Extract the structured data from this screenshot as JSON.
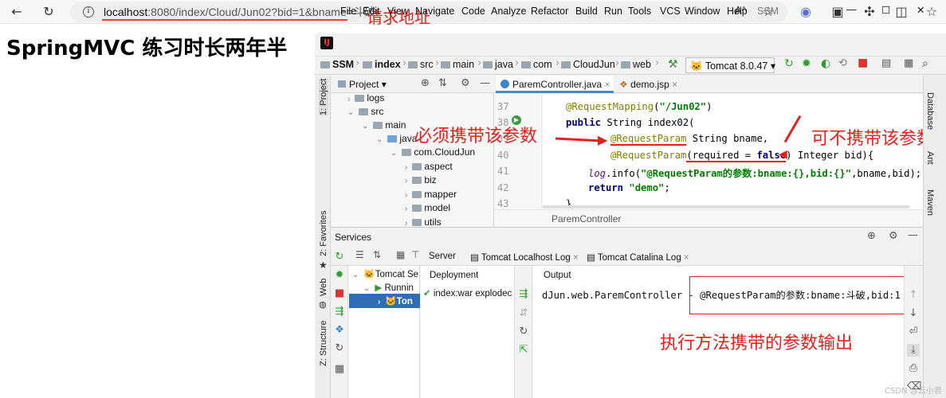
{
  "browser": {
    "url_host": "localhost",
    "url_rest": ":8080/index/Cloud/Jun02?bid=1&bname=斗破",
    "icons": [
      "back-icon",
      "refresh-icon",
      "info-icon",
      "read-aloud-icon",
      "favorite-icon",
      "extension-icon",
      "collections-icon",
      "puzzle-icon",
      "split-screen-icon",
      "favorites-bar-icon"
    ]
  },
  "annotations": {
    "url": "请求地址",
    "required_param": "必须携带该参数",
    "optional_param": "可不携带该参数",
    "output": "执行方法携带的参数输出",
    "accent_color": "#e8201a"
  },
  "page": {
    "heading": "SpringMVC 练习时长两年半"
  },
  "ide": {
    "menus": [
      "File",
      "Edit",
      "View",
      "Navigate",
      "Code",
      "Analyze",
      "Refactor",
      "Build",
      "Run",
      "Tools",
      "VCS",
      "Window",
      "Help",
      "SSM"
    ],
    "window_controls": [
      "—",
      "☐",
      "✕"
    ],
    "breadcrumbs": [
      "SSM",
      "index",
      "src",
      "main",
      "java",
      "com",
      "CloudJun",
      "web"
    ],
    "run_config": "Tomcat 8.0.47",
    "left_stripe": [
      "1: Project",
      "2: Favorites",
      "Web",
      "Z: Structure"
    ],
    "right_stripe": [
      "Database",
      "Ant",
      "Maven"
    ],
    "project": {
      "title": "Project",
      "tree": [
        "logs",
        "src",
        "main",
        "java",
        "com.CloudJun",
        "aspect",
        "biz",
        "mapper",
        "model",
        "utils"
      ]
    },
    "tabs": [
      "ParemController.java",
      "demo.jsp"
    ],
    "line_numbers": [
      "37",
      "38",
      "39",
      "40",
      "41",
      "42",
      "43"
    ],
    "code": {
      "l37_ann": "@RequestMapping",
      "l37_rest_a": "(",
      "l37_str": "\"/Jun02\"",
      "l37_rest_b": ")",
      "l38_kw": "public",
      "l38_rest": " String index02(",
      "l39_ann": "@RequestParam",
      "l39_rest": " String bname,",
      "l40_ann": "@RequestParam",
      "l40_a": "(required = ",
      "l40_kw": "false",
      "l40_b": ") Integer bid){",
      "l41_it": "log",
      "l41_a": ".info(",
      "l41_str": "\"@RequestParam的参数:bname:{},bid:{}\"",
      "l41_b": ",bname,bid);",
      "l42_kw": "return",
      "l42_str": " \"demo\"",
      "l42_b": ";",
      "l43": "}"
    },
    "editor_breadcrumb": "ParemController",
    "services": {
      "title": "Services",
      "tabs": [
        "Server",
        "Tomcat Localhost Log",
        "Tomcat Catalina Log"
      ],
      "tree": [
        "Tomcat Se",
        "Runnin",
        "Ton"
      ],
      "deployment_header": "Deployment",
      "deployment_item": "index:war explodec",
      "output_header": "Output",
      "output_prefix": "dJun.web.ParemController - ",
      "output_value": "@RequestParam的参数:bname:斗破,bid:1"
    }
  },
  "watermark": "CSDN @云小君"
}
